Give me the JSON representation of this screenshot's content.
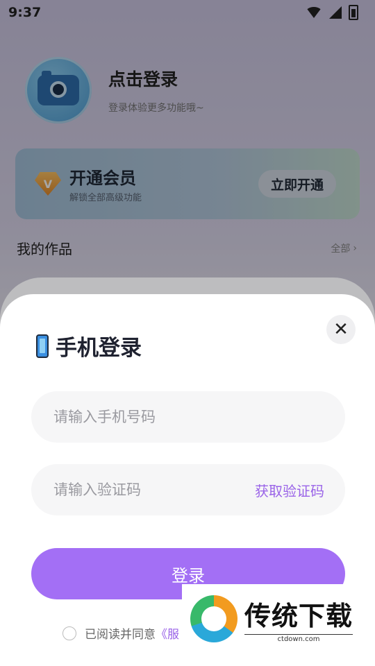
{
  "status_bar": {
    "time": "9:37"
  },
  "profile": {
    "title": "点击登录",
    "subtitle": "登录体验更多功能哦~"
  },
  "vip_card": {
    "badge_letter": "V",
    "title": "开通会员",
    "subtitle": "解锁全部高级功能",
    "button": "立即开通"
  },
  "works": {
    "label": "我的作品",
    "all": "全部",
    "chevron": "›"
  },
  "login_sheet": {
    "title": "手机登录",
    "close": "✕",
    "phone_placeholder": "请输入手机号码",
    "code_placeholder": "请输入验证码",
    "get_code": "获取验证码",
    "login_button": "登录",
    "agreement_prefix": "已阅读并同意",
    "agreement_link": "《服"
  },
  "watermark": {
    "brand": "传统下载",
    "domain": "ctdown.com"
  },
  "colors": {
    "accent": "#a36ff5",
    "link": "#9a63e8"
  }
}
